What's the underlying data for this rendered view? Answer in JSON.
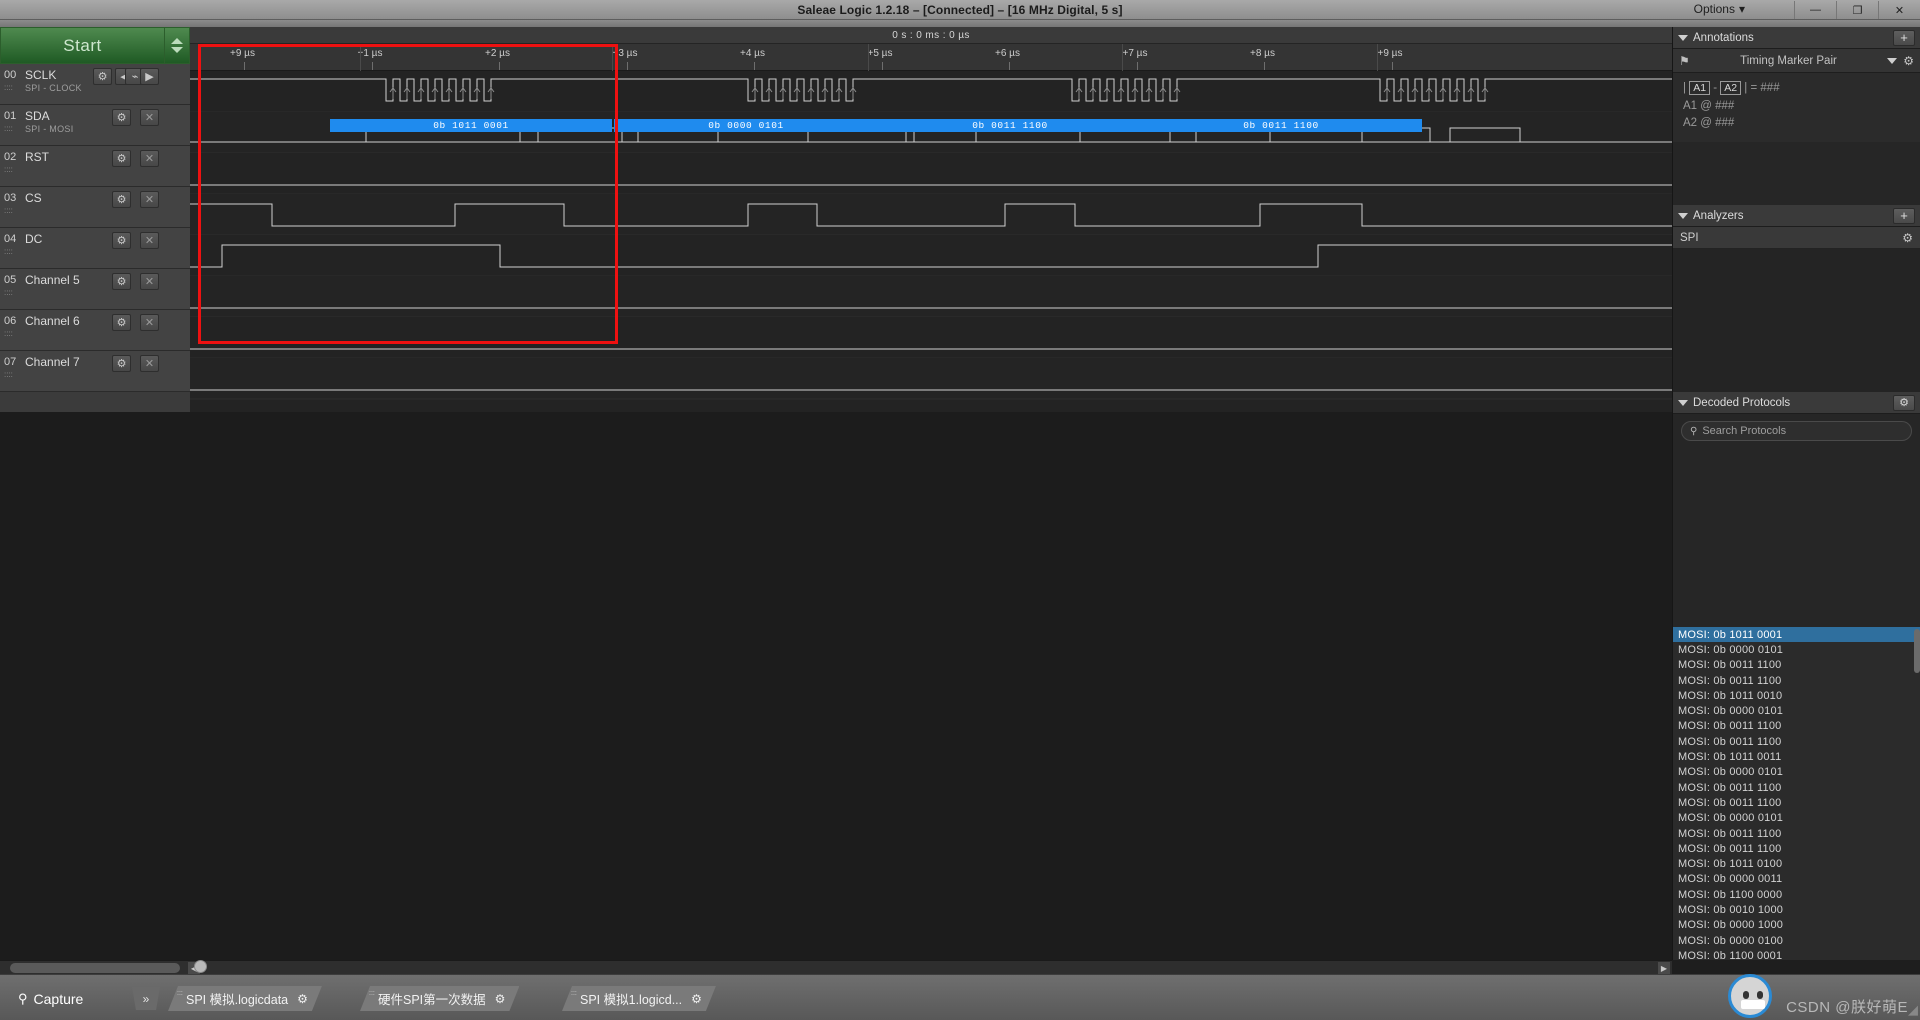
{
  "window": {
    "title": "Saleae Logic 1.2.18 – [Connected] – [16 MHz Digital, 5 s]",
    "options_label": "Options",
    "minimize": "—",
    "restore": "❐",
    "close": "✕"
  },
  "start": {
    "label": "Start"
  },
  "channels": [
    {
      "num": "00",
      "name": "SCLK",
      "sub": "SPI - CLOCK",
      "color": "#262626",
      "has_edge_ctrl": true
    },
    {
      "num": "01",
      "name": "SDA",
      "sub": "SPI - MOSI",
      "color": "#8a6234",
      "has_edge_ctrl": false
    },
    {
      "num": "02",
      "name": "RST",
      "sub": "",
      "color": "#c32020",
      "has_edge_ctrl": false
    },
    {
      "num": "03",
      "name": "CS",
      "sub": "",
      "color": "#e08a15",
      "has_edge_ctrl": false
    },
    {
      "num": "04",
      "name": "DC",
      "sub": "",
      "color": "#e3d72a",
      "has_edge_ctrl": false
    },
    {
      "num": "05",
      "name": "Channel 5",
      "sub": "",
      "color": "#4cae3f",
      "has_edge_ctrl": false
    },
    {
      "num": "06",
      "name": "Channel 6",
      "sub": "",
      "color": "#2f6fd0",
      "has_edge_ctrl": false
    },
    {
      "num": "07",
      "name": "Channel 7",
      "sub": "",
      "color": "#9b3fd4",
      "has_edge_ctrl": false
    }
  ],
  "channel_buttons": {
    "gear": "⚙",
    "close": "✕",
    "prev": "◀",
    "next": "▶",
    "edge": "⌁"
  },
  "timeline": {
    "current_time": "0 s : 0 ms : 0 µs",
    "ticks": [
      "+9 µs",
      "+1 µs",
      "+2 µs",
      "+3 µs",
      "+4 µs",
      "+5 µs",
      "+6 µs",
      "+7 µs",
      "+8 µs",
      "+9 µs"
    ]
  },
  "decoded_bars": [
    {
      "label": "0b 1011 0001"
    },
    {
      "label": "0b 0000 0101"
    },
    {
      "label": "0b 0011 1100"
    },
    {
      "label": "0b 0011 1100"
    }
  ],
  "annotations": {
    "title": "Annotations",
    "add": "+",
    "marker_label": "Timing Marker Pair",
    "flag_icon": "⚑",
    "gear": "⚙",
    "caret": "▼",
    "lines": [
      {
        "prefix": "|",
        "a": "A1",
        "sep": "-",
        "b": "A2",
        "suffix": "| = ###"
      }
    ],
    "a1_line": "A1  @  ###",
    "a2_line": "A2  @  ###"
  },
  "analyzers": {
    "title": "Analyzers",
    "add": "+",
    "items": [
      {
        "name": "SPI",
        "gear": "⚙"
      }
    ]
  },
  "decoded_protocols": {
    "title": "Decoded Protocols",
    "gear": "⚙",
    "search_placeholder": "Search Protocols",
    "search_icon": "🔍",
    "rows": [
      "MOSI: 0b 1011 0001",
      "MOSI: 0b 0000 0101",
      "MOSI: 0b 0011 1100",
      "MOSI: 0b 0011 1100",
      "MOSI: 0b 1011 0010",
      "MOSI: 0b 0000 0101",
      "MOSI: 0b 0011 1100",
      "MOSI: 0b 0011 1100",
      "MOSI: 0b 1011 0011",
      "MOSI: 0b 0000 0101",
      "MOSI: 0b 0011 1100",
      "MOSI: 0b 0011 1100",
      "MOSI: 0b 0000 0101",
      "MOSI: 0b 0011 1100",
      "MOSI: 0b 0011 1100",
      "MOSI: 0b 1011 0100",
      "MOSI: 0b 0000 0011",
      "MOSI: 0b 1100 0000",
      "MOSI: 0b 0010 1000",
      "MOSI: 0b 0000 1000",
      "MOSI: 0b 0000 0100",
      "MOSI: 0b 1100 0001"
    ],
    "selected_index": 0
  },
  "bottom": {
    "capture_label": "Capture",
    "capture_icon": "search-list-icon",
    "expand": "»",
    "tabs": [
      {
        "label": "SPI 模拟.logicdata",
        "gear": "⚙"
      },
      {
        "label": "硬件SPI第一次数据",
        "gear": "⚙"
      },
      {
        "label": "SPI 模拟1.logicd...",
        "gear": "⚙"
      }
    ],
    "watermark": "CSDN @朕好萌E"
  },
  "colors": {
    "accent_blue": "#1f8bee",
    "selection_blue": "#2f6f9e",
    "red_box": "#ee1111",
    "start_green": "#2c5e2c"
  }
}
